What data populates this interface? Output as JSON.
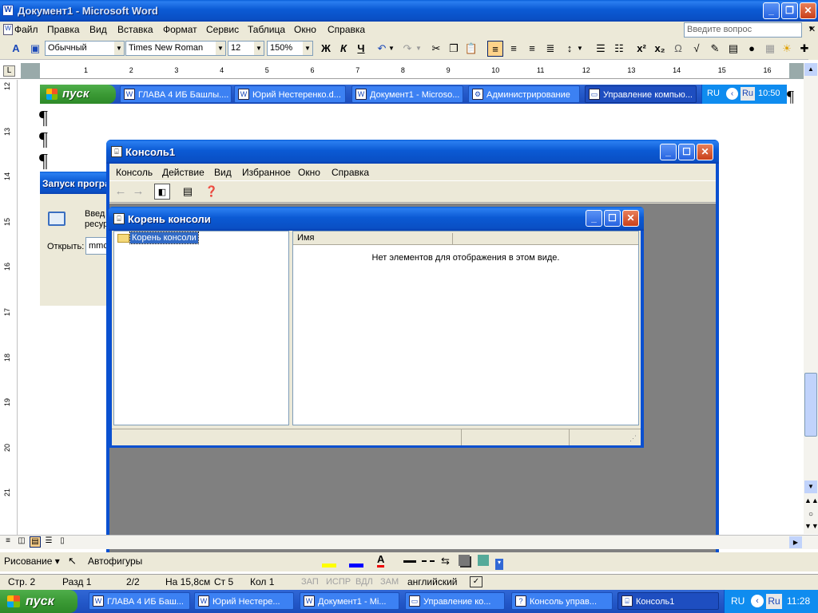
{
  "word": {
    "title": "Документ1 - Microsoft Word",
    "menu": [
      "Файл",
      "Правка",
      "Вид",
      "Вставка",
      "Формат",
      "Сервис",
      "Таблица",
      "Окно",
      "Справка"
    ],
    "help_placeholder": "Введите вопрос",
    "style_value": "Обычный",
    "font_value": "Times New Roman",
    "size_value": "12",
    "zoom_value": "150%",
    "bold": "Ж",
    "italic": "К",
    "underline": "Ч",
    "ruler_numbers": [
      "1",
      "2",
      "3",
      "4",
      "5",
      "6",
      "7",
      "8",
      "9",
      "10",
      "11",
      "12",
      "13",
      "14",
      "15",
      "16"
    ],
    "vruler_numbers": [
      "12",
      "13",
      "14",
      "15",
      "16",
      "17",
      "18",
      "19",
      "20",
      "21"
    ],
    "paragraph_mark": "¶",
    "draw_label": "Рисование",
    "autoshapes_label": "Автофигуры",
    "status": {
      "page": "Стр. 2",
      "section": "Разд 1",
      "pages": "2/2",
      "at": "На 15,8см",
      "line": "Ст 5",
      "col": "Кол 1",
      "rec": "ЗАП",
      "trk": "ИСПР",
      "ext": "ВДЛ",
      "ovr": "ЗАМ",
      "lang": "английский"
    }
  },
  "inner_taskbar": {
    "start": "пуск",
    "tasks": [
      "ГЛАВА 4 ИБ Башлы....",
      "Юрий Нестеренко.d...",
      "Документ1 - Microso...",
      "Администрирование",
      "Управление компью..."
    ],
    "lang": "RU",
    "lang2": "Ru",
    "clock": "10:50"
  },
  "run_dialog": {
    "title": "Запуск програ",
    "prompt_line1": "Введ",
    "prompt_line2": "ресур",
    "open_label": "Открыть:",
    "open_value": "mmc"
  },
  "console": {
    "title": "Консоль1",
    "menu": [
      "Консоль",
      "Действие",
      "Вид",
      "Избранное",
      "Окно",
      "Справка"
    ],
    "child_title": "Корень консоли",
    "tree_root": "Корень консоли",
    "col_name": "Имя",
    "empty_message": "Нет элементов для отображения в этом виде."
  },
  "taskbar": {
    "start": "пуск",
    "tasks": [
      "ГЛАВА 4 ИБ Баш...",
      "Юрий Нестере...",
      "Документ1 - Mi...",
      "Управление ко...",
      "Консоль управ...",
      "Консоль1"
    ],
    "lang": "RU",
    "lang2": "Ru",
    "clock": "11:28"
  },
  "colors": {
    "xp_blue": "#0a5fd8",
    "start_green": "#3b9a35",
    "workspace_gray": "#808080",
    "face": "#ece9d8"
  }
}
